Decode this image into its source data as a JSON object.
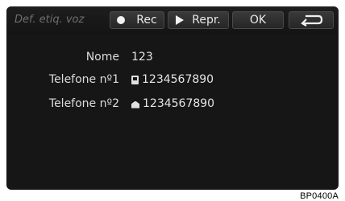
{
  "toolbar": {
    "title": "Def. etiq. voz",
    "rec_label": "Rec",
    "repr_label": "Repr.",
    "ok_label": "OK",
    "back_icon": "back-arrow-icon"
  },
  "rows": [
    {
      "label": "Nome",
      "value": "123"
    },
    {
      "label": "Telefone nº1",
      "value": "1234567890",
      "icon": "mobile-phone-icon"
    },
    {
      "label": "Telefone nº2",
      "value": "1234567890",
      "icon": "home-phone-icon"
    }
  ],
  "footer": {
    "code": "BP0400A"
  },
  "colors": {
    "screen_bg": "#161616",
    "button_bg": "#2e2e2e",
    "text": "#e6e6e6",
    "title": "#6e6e6e"
  }
}
